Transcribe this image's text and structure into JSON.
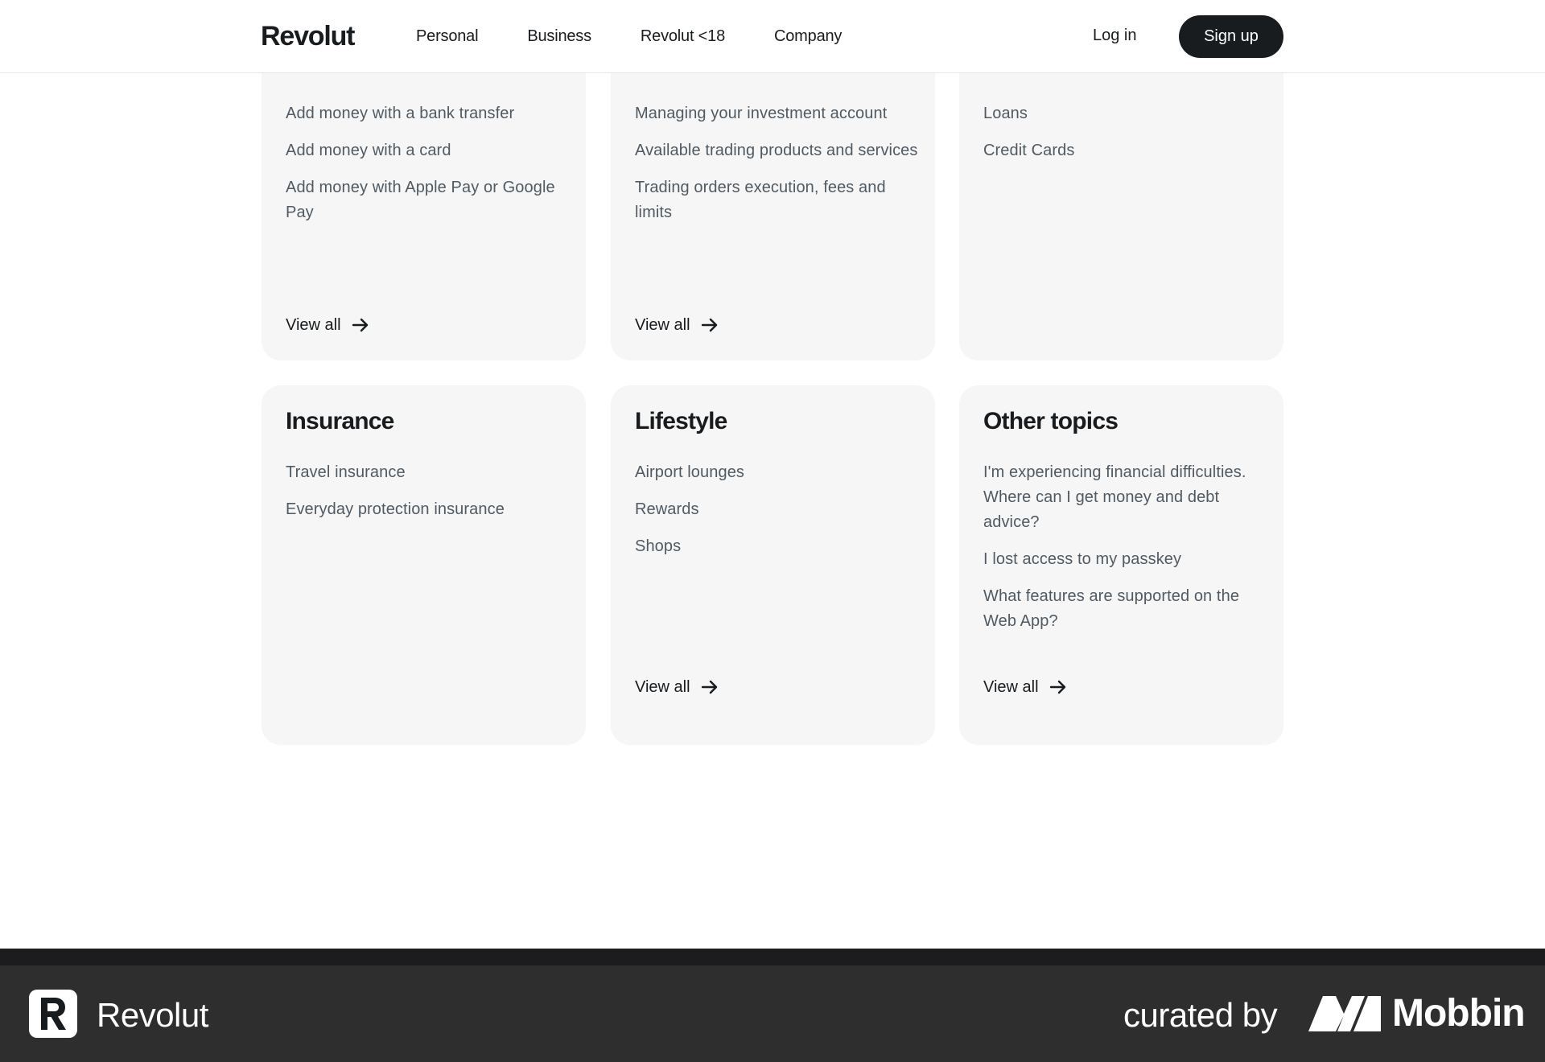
{
  "header": {
    "brand": "Revolut",
    "nav": [
      "Personal",
      "Business",
      "Revolut <18",
      "Company"
    ],
    "login": "Log in",
    "signup": "Sign up"
  },
  "cards_row1": [
    {
      "links": [
        "Add money with a bank transfer",
        "Add money with a card",
        "Add money with Apple Pay or Google Pay"
      ],
      "view_all": "View all"
    },
    {
      "links": [
        "Managing your investment account",
        "Available trading products and services",
        "Trading orders execution, fees and limits"
      ],
      "view_all": "View all"
    },
    {
      "links": [
        "Loans",
        "Credit Cards"
      ]
    }
  ],
  "cards_row2": [
    {
      "title": "Insurance",
      "links": [
        "Travel insurance",
        "Everyday protection insurance"
      ]
    },
    {
      "title": "Lifestyle",
      "links": [
        "Airport lounges",
        "Rewards",
        "Shops"
      ],
      "view_all": "View all"
    },
    {
      "title": "Other topics",
      "links": [
        "I'm experiencing financial difficulties. Where can I get money and debt advice?",
        "I lost access to my passkey",
        "What features are supported on the Web App?"
      ],
      "view_all": "View all"
    }
  ],
  "footer": {
    "brand": "Revolut",
    "curated_by": "curated by",
    "mobbin": "Mobbin"
  },
  "colors": {
    "card_bg": "#f6f6f6",
    "text_dark": "#191c1f",
    "text_muted": "#505a63",
    "footer_bg": "#2e2e2e"
  }
}
